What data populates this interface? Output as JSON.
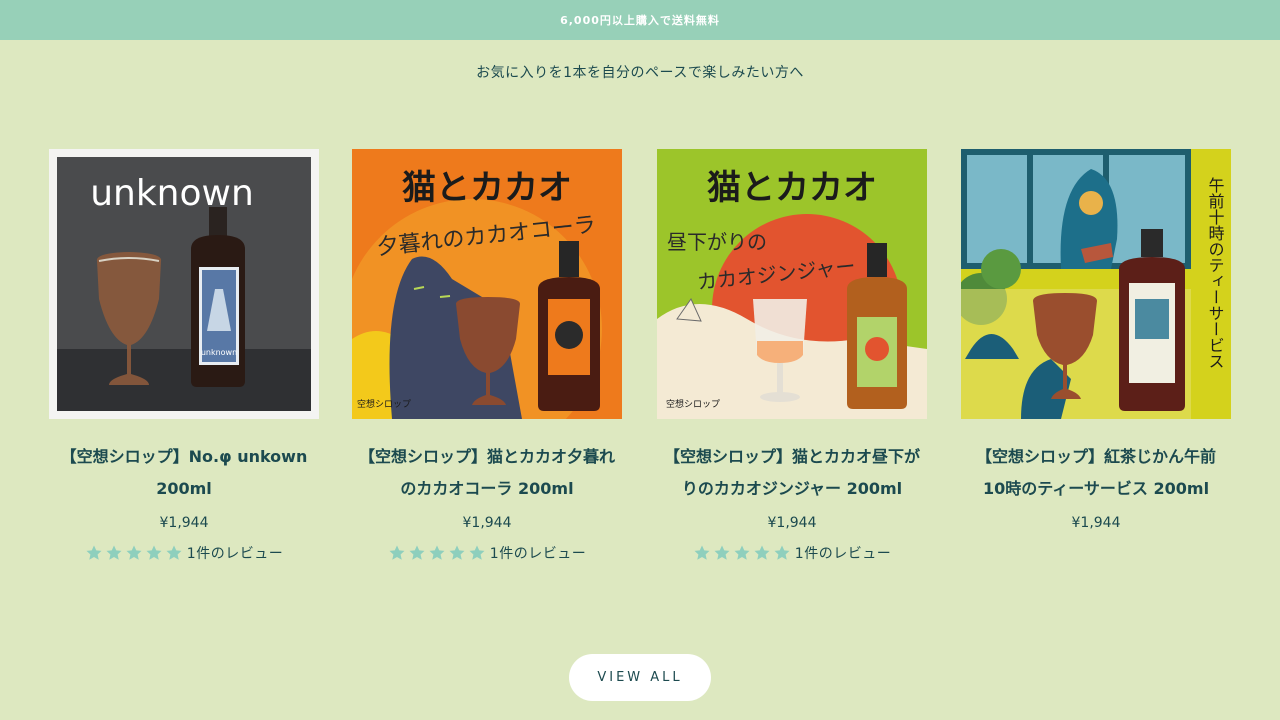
{
  "announcement": "6,000円以上購入で送料無料",
  "subtitle": "お気に入りを1本を自分のペースで楽しみたい方へ",
  "products": [
    {
      "title": "【空想シロップ】No.φ unkown 200ml",
      "price": "¥1,944",
      "rating": 5,
      "reviews": "1件のレビュー",
      "image_text": {
        "headline": "unknown",
        "label": "unknown"
      }
    },
    {
      "title": "【空想シロップ】猫とカカオ夕暮れのカカオコーラ 200ml",
      "price": "¥1,944",
      "rating": 5,
      "reviews": "1件のレビュー",
      "image_text": {
        "headline": "猫とカカオ",
        "sub": "夕暮れのカカオコーラ",
        "brand": "空想シロップ"
      }
    },
    {
      "title": "【空想シロップ】猫とカカオ昼下がりのカカオジンジャー 200ml",
      "price": "¥1,944",
      "rating": 5,
      "reviews": "1件のレビュー",
      "image_text": {
        "headline": "猫とカカオ",
        "sub1": "昼下がりの",
        "sub2": "カカオジンジャー",
        "brand": "空想シロップ"
      }
    },
    {
      "title": "【空想シロップ】紅茶じかん午前 10時のティーサービス 200ml",
      "price": "¥1,944",
      "image_text": {
        "vertical": "午前十時のティーサービス"
      }
    }
  ],
  "view_all": "VIEW ALL",
  "colors": {
    "bar": "#97d0b8",
    "bg": "#dde8c0",
    "text": "#1c4a4f",
    "star": "#8ecfbd"
  }
}
